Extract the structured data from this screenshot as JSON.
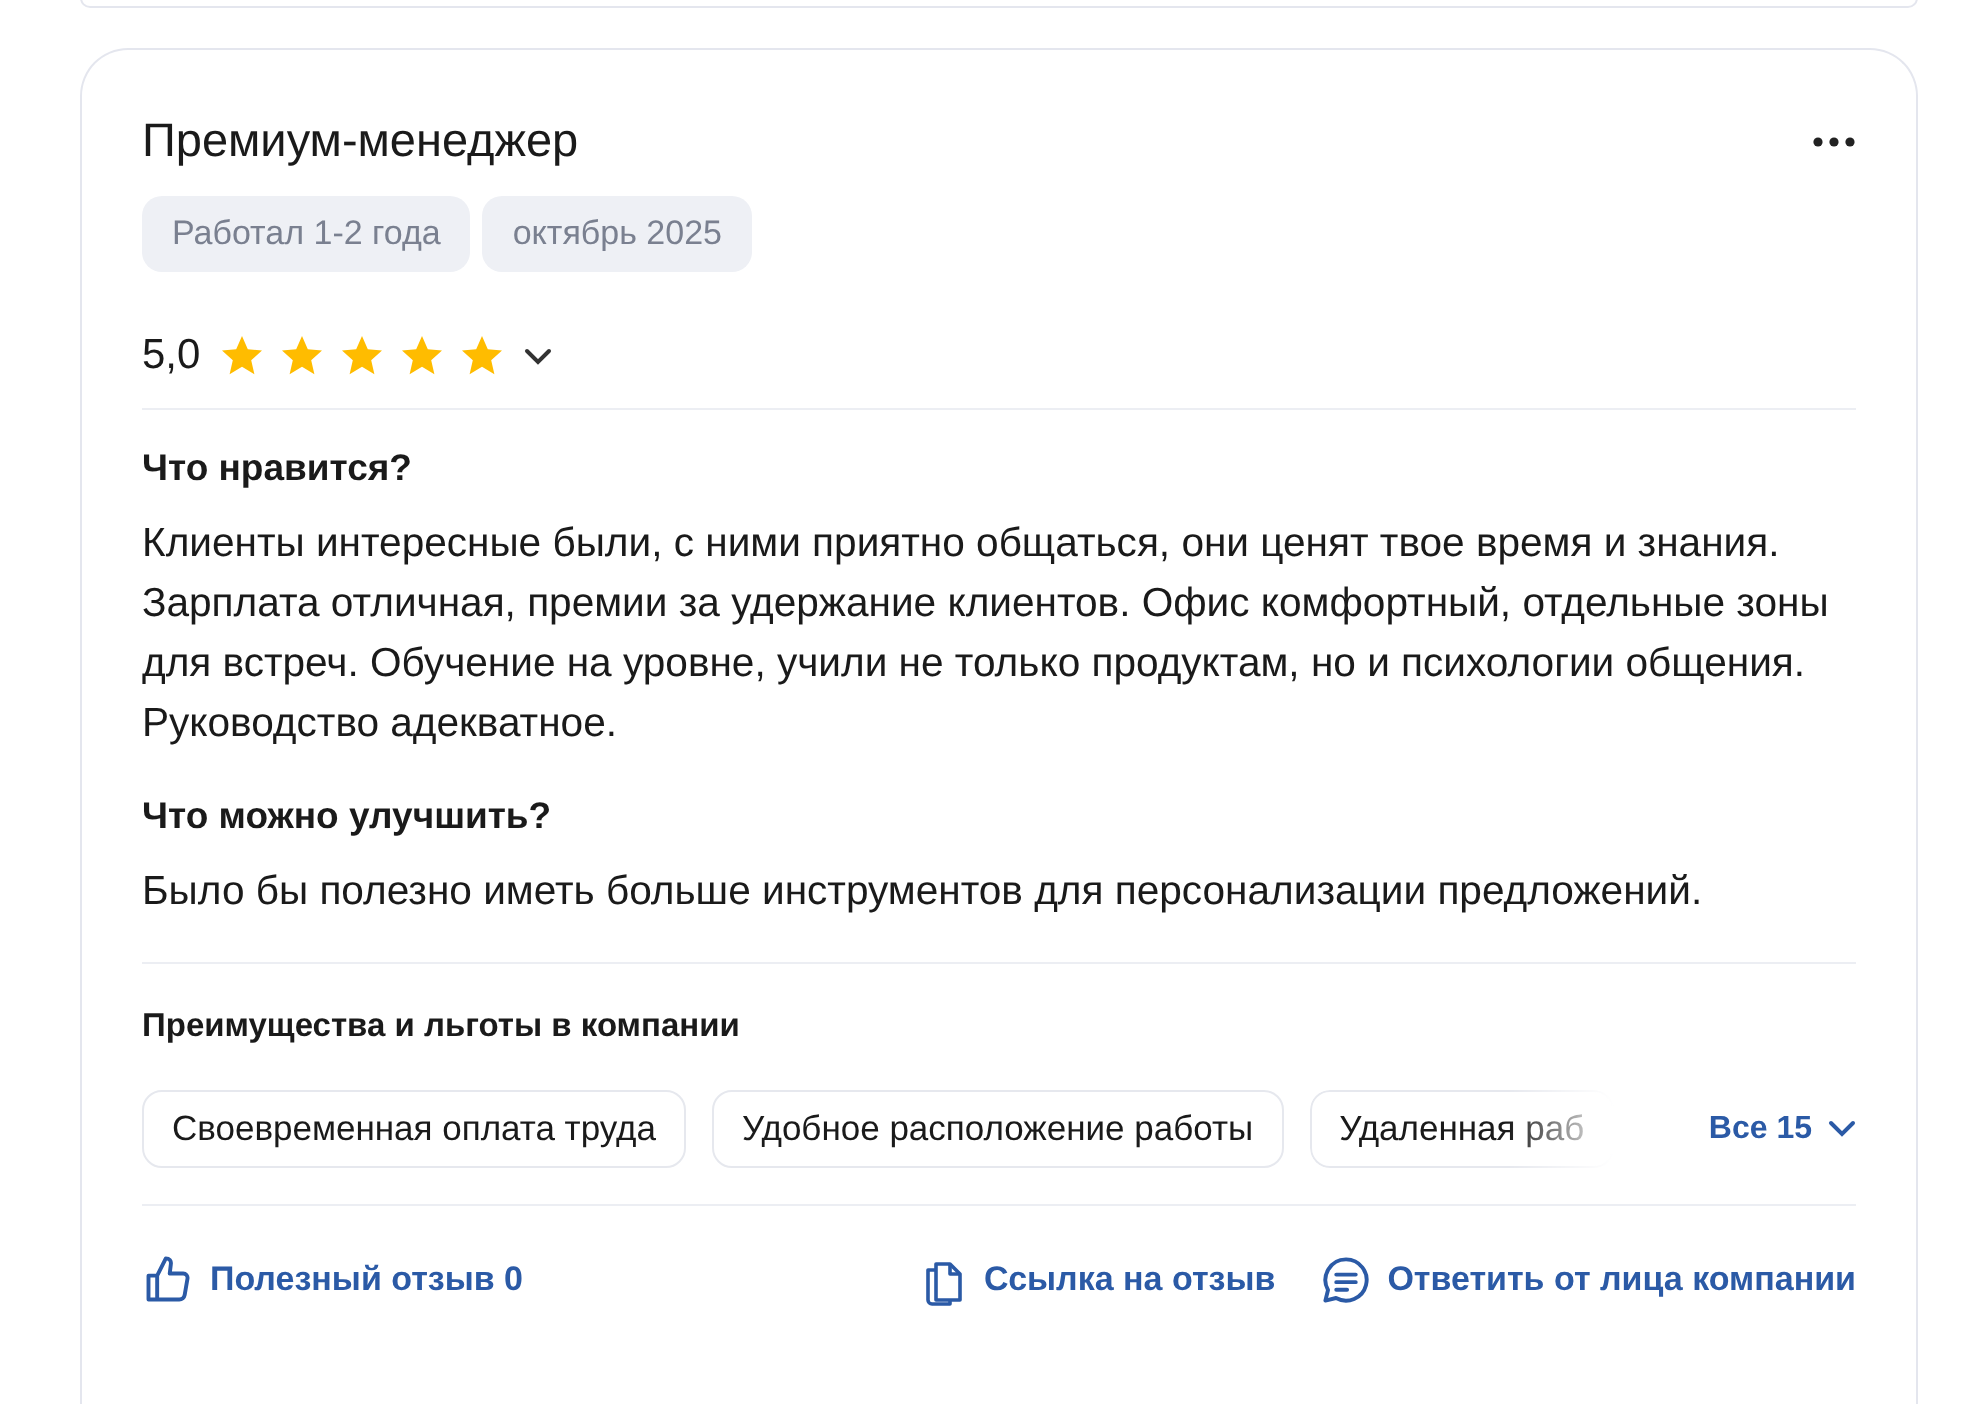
{
  "review": {
    "title": "Премиум-менеджер",
    "tags": [
      "Работал 1-2 года",
      "октябрь 2025"
    ],
    "rating": "5,0",
    "stars": 5,
    "sections": [
      {
        "heading": "Что нравится?",
        "text": "Клиенты интересные были, с ними приятно общаться, они ценят твое время и знания. Зарплата отличная, премии за удержание клиентов. Офис комфортный, отдельные зоны для встреч. Обучение на уровне, учили не только продуктам, но и психологии общения. Руководство адекватное."
      },
      {
        "heading": "Что можно улучшить?",
        "text": "Было бы полезно иметь больше инструментов для персонализации предложений."
      }
    ],
    "benefits": {
      "heading": "Преимущества и льготы в компании",
      "chips": [
        "Своевременная оплата труда",
        "Удобное расположение работы",
        "Удаленная раб"
      ],
      "more": "Все 15"
    },
    "actions": {
      "helpful": "Полезный отзыв 0",
      "link": "Ссылка на отзыв",
      "reply": "Ответить от лица компании"
    }
  }
}
